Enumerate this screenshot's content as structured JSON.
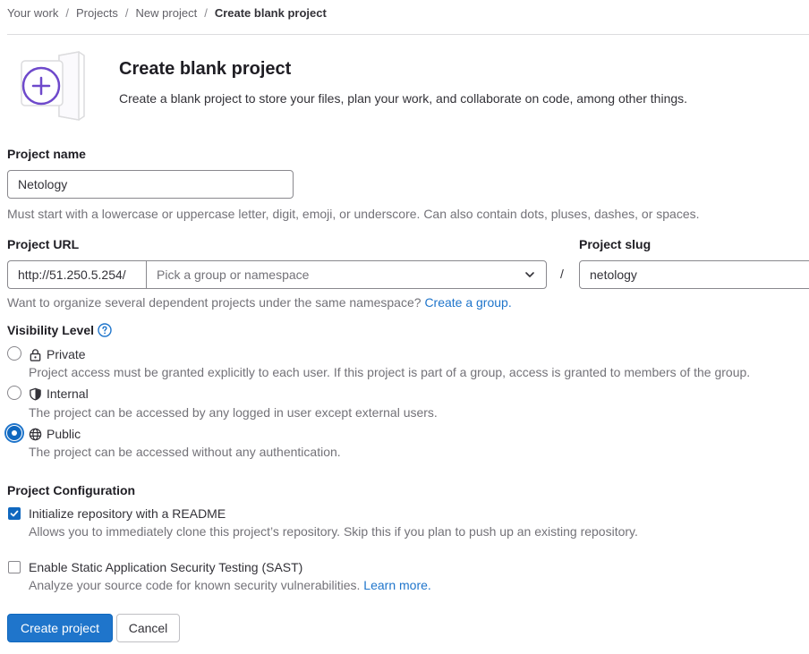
{
  "breadcrumbs": [
    "Your work",
    "Projects",
    "New project",
    "Create blank project"
  ],
  "header": {
    "title": "Create blank project",
    "description": "Create a blank project to store your files, plan your work, and collaborate on code, among other things."
  },
  "project_name": {
    "label": "Project name",
    "value": "Netology",
    "help": "Must start with a lowercase or uppercase letter, digit, emoji, or underscore. Can also contain dots, pluses, dashes, or spaces."
  },
  "project_url": {
    "label": "Project URL",
    "prefix": "http://51.250.5.254/",
    "namespace_placeholder": "Pick a group or namespace",
    "separator": "/",
    "help_text": "Want to organize several dependent projects under the same namespace?",
    "help_link": "Create a group."
  },
  "project_slug": {
    "label": "Project slug",
    "value": "netology"
  },
  "visibility": {
    "label": "Visibility Level",
    "options": [
      {
        "title": "Private",
        "icon": "lock-icon",
        "description": "Project access must be granted explicitly to each user. If this project is part of a group, access is granted to members of the group.",
        "selected": false
      },
      {
        "title": "Internal",
        "icon": "shield-icon",
        "description": "The project can be accessed by any logged in user except external users.",
        "selected": false
      },
      {
        "title": "Public",
        "icon": "globe-icon",
        "description": "The project can be accessed without any authentication.",
        "selected": true
      }
    ]
  },
  "configuration": {
    "label": "Project Configuration",
    "readme": {
      "label": "Initialize repository with a README",
      "description": "Allows you to immediately clone this project’s repository. Skip this if you plan to push up an existing repository.",
      "checked": true
    },
    "sast": {
      "label": "Enable Static Application Security Testing (SAST)",
      "description": "Analyze your source code for known security vulnerabilities.",
      "link": "Learn more.",
      "checked": false
    }
  },
  "actions": {
    "create": "Create project",
    "cancel": "Cancel"
  },
  "colors": {
    "primary": "#1f75cb",
    "accent_purple": "#6e49cb",
    "text": "#333238",
    "muted": "#737278"
  }
}
